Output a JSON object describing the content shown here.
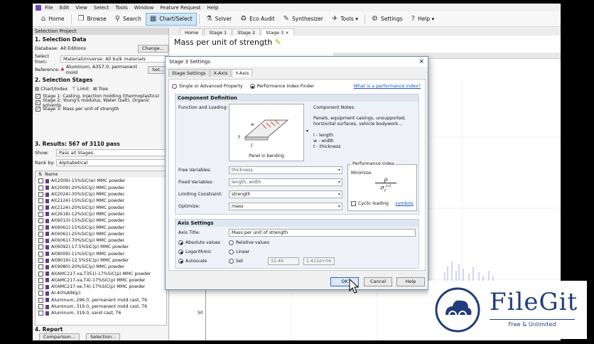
{
  "menu": [
    "File",
    "Edit",
    "View",
    "Select",
    "Tools",
    "Window",
    "Feature Request",
    "Help"
  ],
  "toolbar": [
    {
      "icon": "⌂",
      "label": "Home"
    },
    {
      "icon": "❐",
      "label": "Browse"
    },
    {
      "icon": "⚲",
      "label": "Search"
    },
    {
      "icon": "▦",
      "label": "Chart/Select"
    },
    {
      "icon": "⚗",
      "label": "Solver"
    },
    {
      "icon": "♻",
      "label": "Eco Audit"
    },
    {
      "icon": "✎",
      "label": "Synthesizer"
    },
    {
      "icon": "✈",
      "label": "Tools ▾"
    },
    {
      "icon": "⚙",
      "label": "Settings"
    },
    {
      "icon": "?",
      "label": "Help ▾"
    }
  ],
  "project": {
    "header": "Selection Project",
    "s1": "1. Selection Data",
    "database_label": "Database:",
    "database_value": "All Editions",
    "change_btn": "Change...",
    "select_from_label": "Select from:",
    "select_from_value": "MaterialUniverse: All bulk materials",
    "reference_label": "Reference:",
    "reference_value": "Aluminum, A357.0, permanent mold",
    "set_btn": "Set...",
    "s2": "2. Selection Stages",
    "chart_btn": "Chart/Index",
    "limit_btn": "Limit",
    "tree_btn": "Tree",
    "stages": [
      "Stage 1: Casting, Injection molding (thermoplastics)",
      "Stage 2: Young's modulus, Water (salt), Organic solvents",
      "Stage 3: Mass per unit of strength"
    ],
    "s3": "3. Results: 567 of 3110 pass",
    "show_label": "Show:",
    "show_value": "Pass all Stages",
    "rank_label": "Rank by:",
    "rank_value": "Alphabetical",
    "col_name": "Name",
    "results": [
      "Al(2009)-15%SiC(w) MMC powder",
      "Al(2009)-20%SiC(p) MMC powder",
      "Al(2024)-30%SiC(p) MMC powder",
      "Al(2124)-15%SiC(p) MMC powder",
      "Al(2124)-20%SiC(p) MMC powder",
      "Al(2618)-12%SiC(p) MMC powder",
      "Al(6013)-15%SiC(p) MMC powder",
      "Al(6061)-15%SiC(p) MMC powder",
      "Al(6061)-25%SiC(p) MMC powder",
      "Al(6061)-70%SiC(p) MMC powder",
      "Al(6092)-17.5%SiC(p) MMC powder",
      "Al(8009)-11%SiC(p) MMC powder",
      "Al(8019)-12.5%SiC(p) MMC powder",
      "Al(9080)-20%SiC(p) MMC powder",
      "Al(AMC217-xa,T351)-17%SiC(p) MMC powder",
      "Al(AMC217-xa,T4)-17%SiC(p) MMC powder",
      "Al(AMC217-xe,T4)-17%SiC(p) MMC powder",
      "Al-40%AlN(p)",
      "Aluminum, 296.0, permanent mold cast, T6",
      "Aluminum, 319.0, permanent mold cast, T6",
      "Aluminum, 319.0, sand cast, T6"
    ],
    "s4": "4. Report",
    "comparison_btn": "Comparison...",
    "selection_btn": "Selection..."
  },
  "main": {
    "tabs": [
      "Home",
      "Stage 1",
      "Stage 2",
      "Stage 3 ×"
    ],
    "title": "Mass per unit of strength",
    "ytick": "50"
  },
  "dialog": {
    "title": "Stage 3 Settings",
    "close": "×",
    "tabs": [
      "Stage Settings",
      "X-Axis",
      "Y-Axis"
    ],
    "mode1": "Single or Advanced Property",
    "mode2": "Performance Index Finder",
    "perf_link": "What is a performance index?",
    "component_def": "Component Definition",
    "function_label": "Function and Loading:",
    "panel_caption": "Panel in bending",
    "notes_label": "Component Notes:",
    "notes": "Panels, equipment casings, unsupported, horizontal surfaces, vehicle bodywork...",
    "legend": [
      "l - length",
      "w - width",
      "t - thickness"
    ],
    "free_label": "Free Variables:",
    "free_value": "thickness",
    "fixed_label": "Fixed Variables:",
    "fixed_value": "length, width",
    "limit_label": "Limiting Constraint:",
    "limit_value": "strength",
    "opt_label": "Optimize:",
    "opt_value": "mass",
    "pi_title": "Performance Index",
    "minimize": "Minimize:",
    "num": "ρ",
    "den": "σ",
    "den_exp": "1/2",
    "f_sub": "f",
    "cyclic": "Cyclic loading",
    "symbols": "symbols",
    "axis_settings": "Axis Settings",
    "axis_title_label": "Axis Title:",
    "axis_title_value": "Mass per unit of strength",
    "abs": "Absolute values",
    "rel": "Relative values",
    "log": "Logarithmic",
    "lin": "Linear",
    "auto": "Autoscale",
    "set": "Set",
    "min_val": "15.46",
    "max_val": "1.411e+04",
    "ok": "OK",
    "cancel": "Cancel",
    "help": "Help"
  },
  "watermark": {
    "brand": "FileGit",
    "tagline": "Free & Unlimited"
  }
}
